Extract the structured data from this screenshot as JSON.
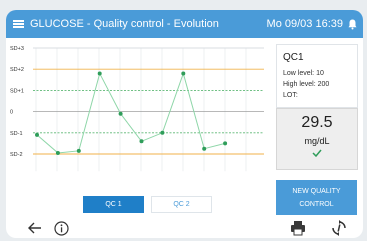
{
  "header": {
    "title": "GLUCOSE - Quality control - Evolution",
    "datetime": "Mo 09/03 16:39",
    "menu_icon": "hamburger-menu-icon",
    "bell_icon": "bell-icon"
  },
  "chart_data": {
    "type": "line",
    "y_levels": [
      "SD+3",
      "SD+2",
      "SD+1",
      "0",
      "SD-1",
      "SD-2"
    ],
    "y_values": [
      3,
      2,
      1,
      0,
      -1,
      -2
    ],
    "series": [
      {
        "values": [
          -1.1,
          -1.95,
          -1.85,
          1.8,
          -0.1,
          -1.4,
          -1.0,
          1.8,
          -1.75,
          -1.5
        ]
      }
    ],
    "ylim": [
      -3,
      3
    ],
    "grid": true,
    "colors": {
      "line": "#8ed6a8",
      "points": "#2f9d5a",
      "sd2": "#f0b24a",
      "sd1": "#5db874",
      "mean": "#a0a0a0"
    }
  },
  "tabs": [
    {
      "label": "QC 1",
      "active": true
    },
    {
      "label": "QC 2",
      "active": false
    }
  ],
  "qc": {
    "name": "QC1",
    "low": "Low level: 10",
    "high": "High level: 200",
    "lot": "LOT:"
  },
  "result": {
    "value": "29.5",
    "unit": "mg/dL",
    "status_icon": "check-icon"
  },
  "actions": {
    "new_qc_line1": "NEW QUALITY",
    "new_qc_line2": "CONTROL",
    "back_icon": "back-arrow-icon",
    "info_icon": "info-icon",
    "print_icon": "printer-icon",
    "sync_icon": "sync-icon"
  }
}
